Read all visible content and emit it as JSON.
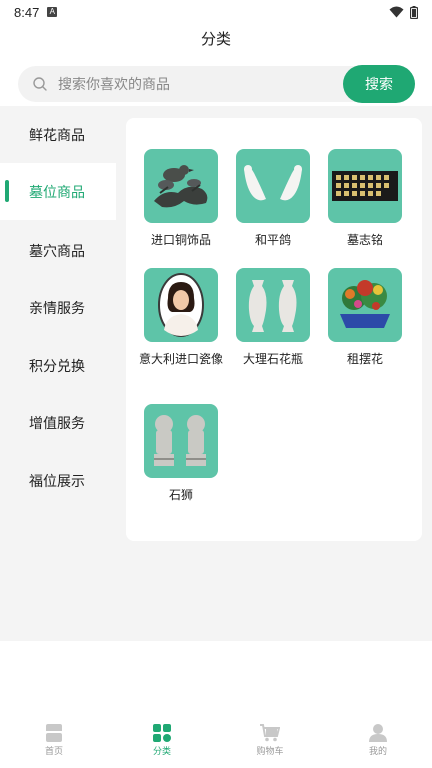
{
  "status": {
    "time": "8:47",
    "a_badge": "A"
  },
  "header": {
    "title": "分类"
  },
  "search": {
    "placeholder": "搜索你喜欢的商品",
    "button_label": "搜索"
  },
  "sidebar": {
    "items": [
      {
        "label": "鲜花商品"
      },
      {
        "label": "墓位商品"
      },
      {
        "label": "墓穴商品"
      },
      {
        "label": "亲情服务"
      },
      {
        "label": "积分兑换"
      },
      {
        "label": "增值服务"
      },
      {
        "label": "福位展示"
      }
    ],
    "active_index": 1
  },
  "products": [
    {
      "name": "进口铜饰品"
    },
    {
      "name": "和平鸽"
    },
    {
      "name": "墓志铭"
    },
    {
      "name": "意大利进口瓷像"
    },
    {
      "name": "大理石花瓶"
    },
    {
      "name": "租摆花"
    },
    {
      "name": "石狮"
    }
  ],
  "nav": {
    "items": [
      {
        "label": "首页"
      },
      {
        "label": "分类"
      },
      {
        "label": "购物车"
      },
      {
        "label": "我的"
      }
    ],
    "active_index": 1
  },
  "colors": {
    "accent": "#1fa873",
    "thumb_bg": "#5ec4a8"
  }
}
